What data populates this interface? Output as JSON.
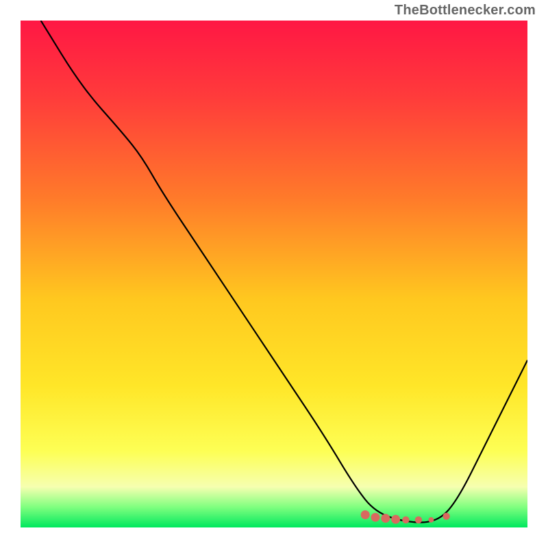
{
  "attribution": "TheBottlenecker.com",
  "chart_data": {
    "type": "line",
    "title": "",
    "xlabel": "",
    "ylabel": "",
    "xlim": [
      0,
      100
    ],
    "ylim": [
      0,
      100
    ],
    "gradient_stops": [
      {
        "offset": 0,
        "color": "#ff1744"
      },
      {
        "offset": 15,
        "color": "#ff3b3b"
      },
      {
        "offset": 35,
        "color": "#ff7a2a"
      },
      {
        "offset": 55,
        "color": "#ffc81f"
      },
      {
        "offset": 72,
        "color": "#ffe628"
      },
      {
        "offset": 85,
        "color": "#fdff55"
      },
      {
        "offset": 92,
        "color": "#f6ffb0"
      },
      {
        "offset": 96,
        "color": "#7fff7f"
      },
      {
        "offset": 100,
        "color": "#00e85e"
      }
    ],
    "series": [
      {
        "name": "bottleneck-curve",
        "color": "#000000",
        "points": [
          {
            "x": 4,
            "y": 100
          },
          {
            "x": 12,
            "y": 87
          },
          {
            "x": 20,
            "y": 78
          },
          {
            "x": 24,
            "y": 73
          },
          {
            "x": 28,
            "y": 66
          },
          {
            "x": 36,
            "y": 54
          },
          {
            "x": 44,
            "y": 42
          },
          {
            "x": 52,
            "y": 30
          },
          {
            "x": 60,
            "y": 18
          },
          {
            "x": 66,
            "y": 8
          },
          {
            "x": 70,
            "y": 3
          },
          {
            "x": 76,
            "y": 1
          },
          {
            "x": 82,
            "y": 1
          },
          {
            "x": 86,
            "y": 5
          },
          {
            "x": 92,
            "y": 17
          },
          {
            "x": 100,
            "y": 33
          }
        ]
      }
    ],
    "markers": {
      "color": "#d9695f",
      "points": [
        {
          "x": 68,
          "y": 2.5,
          "r": 5
        },
        {
          "x": 70,
          "y": 2.0,
          "r": 5
        },
        {
          "x": 72,
          "y": 1.8,
          "r": 5
        },
        {
          "x": 74,
          "y": 1.6,
          "r": 5
        },
        {
          "x": 76,
          "y": 1.5,
          "r": 4
        },
        {
          "x": 78.5,
          "y": 1.5,
          "r": 4
        },
        {
          "x": 81,
          "y": 1.5,
          "r": 3
        },
        {
          "x": 84,
          "y": 2.2,
          "r": 4
        }
      ]
    }
  }
}
